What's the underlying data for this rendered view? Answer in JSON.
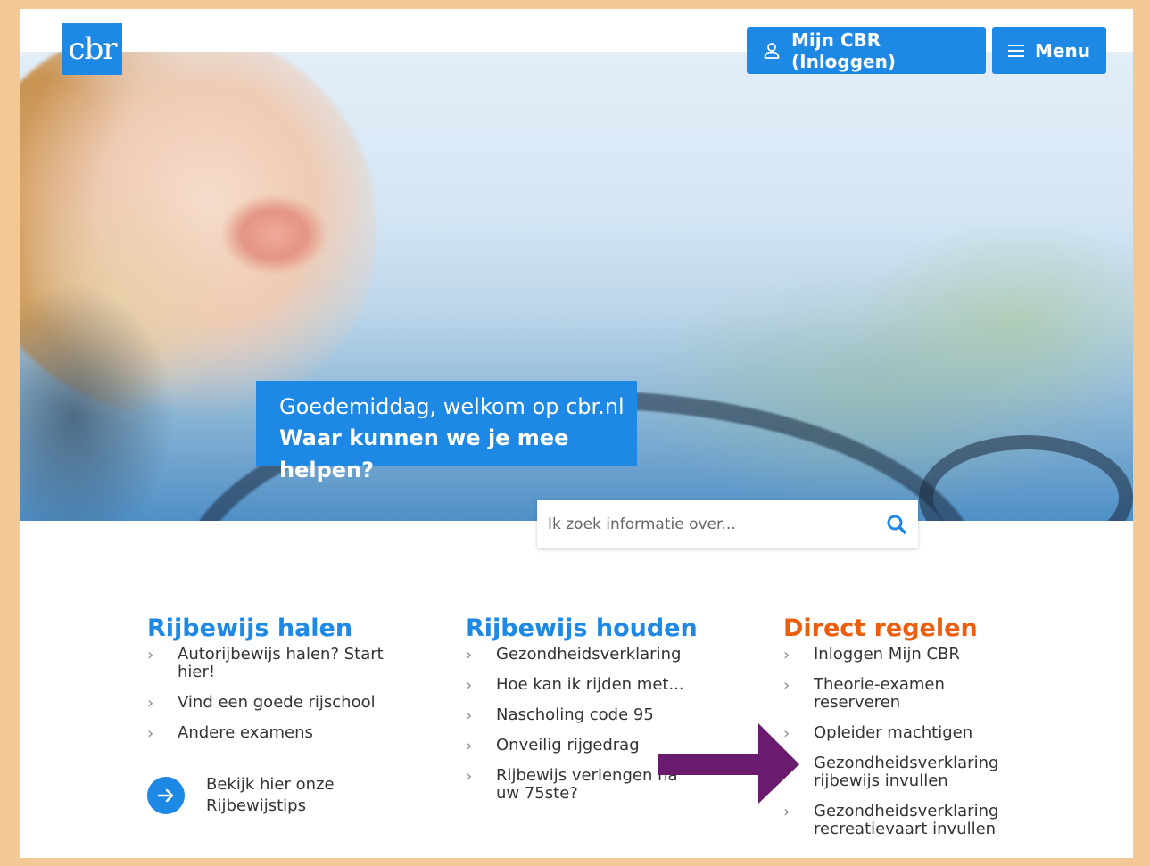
{
  "logo": {
    "text": "cbr"
  },
  "header": {
    "login_label": "Mijn CBR (Inloggen)",
    "menu_label": "Menu"
  },
  "hero": {
    "greeting": "Goedemiddag, welkom op cbr.nl",
    "question": "Waar kunnen we je mee helpen?"
  },
  "search": {
    "placeholder": "Ik zoek informatie over..."
  },
  "columns": {
    "rijbewijs_halen": {
      "title": "Rijbewijs halen",
      "items": [
        "Autorijbewijs halen? Start hier!",
        "Vind een goede rijschool",
        "Andere examens"
      ]
    },
    "rijbewijs_houden": {
      "title": "Rijbewijs houden",
      "items": [
        "Gezondheidsverklaring",
        "Hoe kan ik rijden met...",
        "Nascholing code 95",
        "Onveilig rijgedrag",
        "Rijbewijs verlengen na uw 75ste?"
      ]
    },
    "direct_regelen": {
      "title": "Direct regelen",
      "items": [
        "Inloggen Mijn CBR",
        "Theorie-examen reserveren",
        "Opleider machtigen",
        "Gezondheidsverklaring rijbewijs invullen",
        "Gezondheidsverklaring recreatievaart invullen"
      ]
    }
  },
  "tips": {
    "label": "Bekijk hier onze Rijbewijstips"
  },
  "colors": {
    "brand_blue": "#1e88e5",
    "accent_orange": "#ec5e0d",
    "annotation_arrow": "#6a1b6e",
    "frame": "#f3c894"
  },
  "icons": {
    "login": "user-icon",
    "menu": "hamburger-icon",
    "search": "search-icon",
    "list_bullet": "chevron-right-icon",
    "tips": "arrow-right-icon"
  }
}
